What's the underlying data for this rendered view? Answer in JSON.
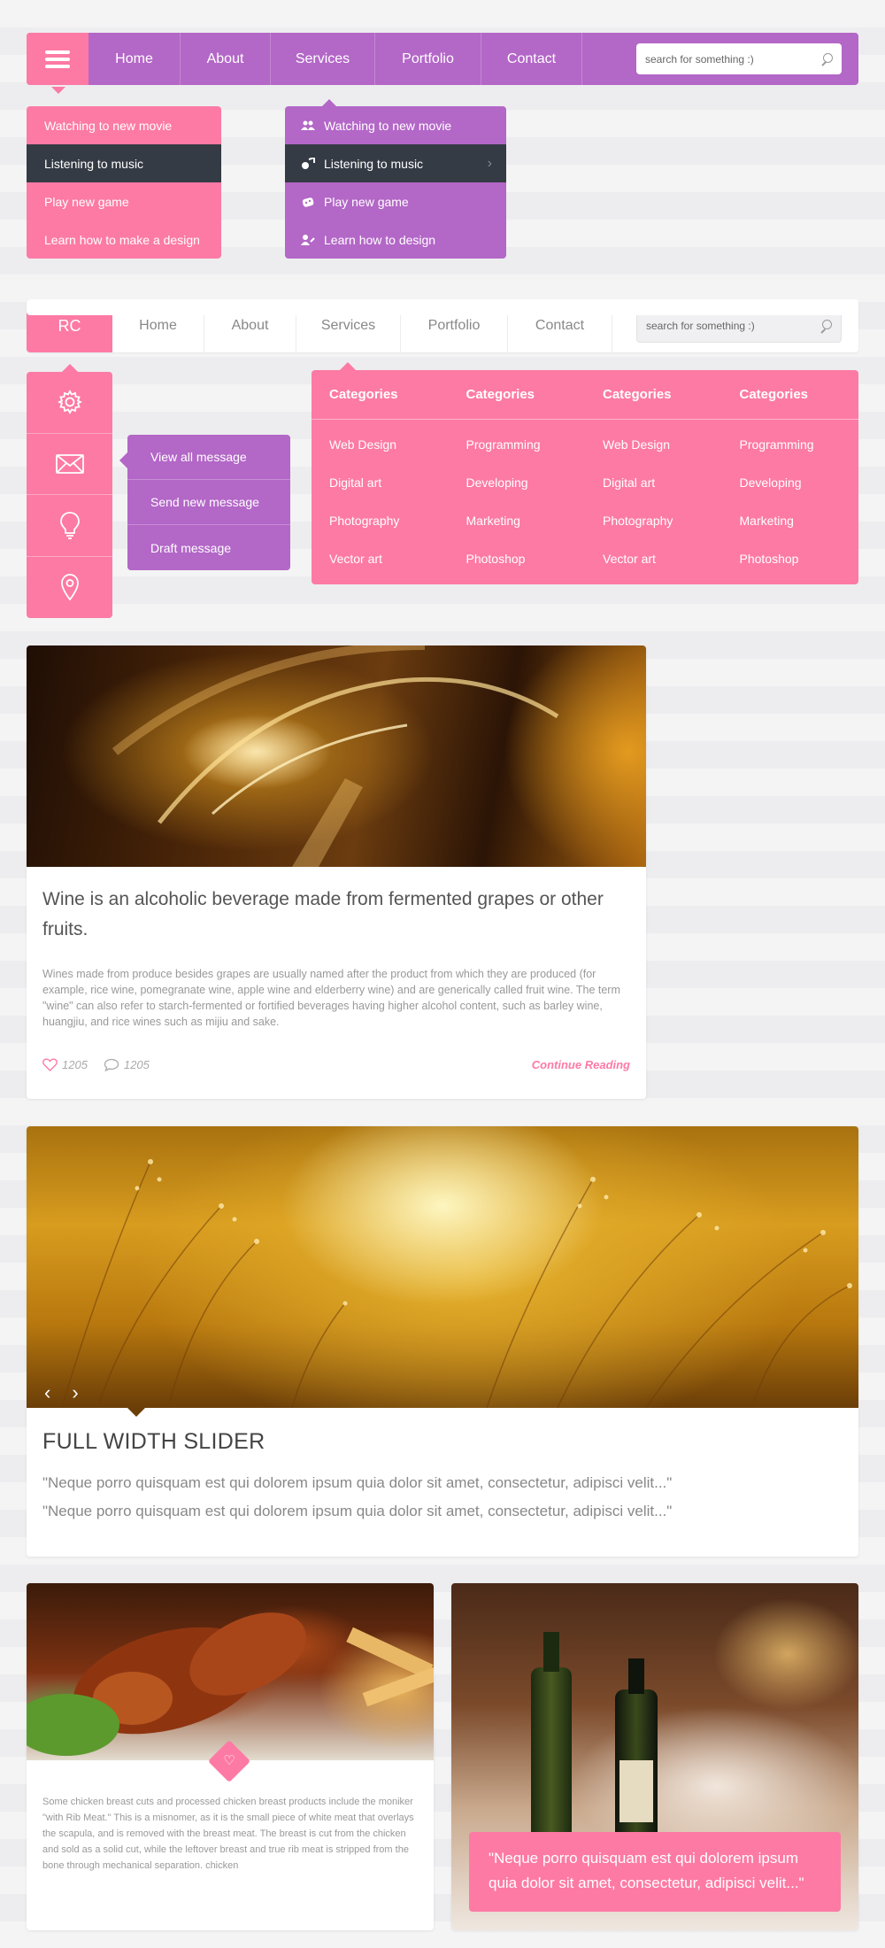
{
  "nav1": {
    "items": [
      "Home",
      "About",
      "Services",
      "Portfolio",
      "Contact"
    ],
    "search_placeholder": "search for something :)"
  },
  "dropdown1": {
    "items": [
      "Watching to new movie",
      "Listening to music",
      "Play new game",
      "Learn how to make a design"
    ]
  },
  "dropdown2": {
    "items": [
      "Watching to new movie",
      "Listening to music",
      "Play new game",
      "Learn how to design"
    ],
    "icons": [
      "users-icon",
      "music-icon",
      "gamepad-icon",
      "user-edit-icon"
    ]
  },
  "nav2": {
    "logo": "RC",
    "items": [
      "Home",
      "About",
      "Services",
      "Portfolio",
      "Contact"
    ],
    "search_placeholder": "search for something :)"
  },
  "iconbar": {
    "icons": [
      "gear-icon",
      "mail-icon",
      "lightbulb-icon",
      "location-pin-icon"
    ]
  },
  "message_menu": {
    "items": [
      "View all message",
      "Send new message",
      "Draft message"
    ]
  },
  "mega_menu": {
    "columns": [
      {
        "heading": "Categories",
        "links": [
          "Web Design",
          "Digital art",
          "Photography",
          "Vector art"
        ]
      },
      {
        "heading": "Categories",
        "links": [
          "Programming",
          "Developing",
          "Marketing",
          "Photoshop"
        ]
      },
      {
        "heading": "Categories",
        "links": [
          "Web Design",
          "Digital art",
          "Photography",
          "Vector art"
        ]
      },
      {
        "heading": "Categories",
        "links": [
          "Programming",
          "Developing",
          "Marketing",
          "Photoshop"
        ]
      }
    ]
  },
  "wine_card": {
    "title": "Wine is an alcoholic beverage made from fermented grapes or other fruits.",
    "text": "Wines made from produce besides grapes are usually named after the product from which they are produced (for example, rice wine, pomegranate wine, apple wine and elderberry wine) and are generically called fruit wine. The term \"wine\" can also refer to starch-fermented or fortified beverages having higher alcohol content, such as barley wine, huangjiu, and rice wines such as mijiu and sake.",
    "likes": "1205",
    "comments": "1205",
    "continue_label": "Continue Reading"
  },
  "slider": {
    "title": "FULL WIDTH SLIDER",
    "quote1": "\"Neque porro quisquam est qui dolorem ipsum quia dolor sit amet, consectetur, adipisci velit...\"",
    "quote2": "\"Neque porro quisquam est qui dolorem ipsum quia dolor sit amet, consectetur, adipisci velit...\"",
    "prev": "‹",
    "next": "›"
  },
  "chicken_card": {
    "text": "Some chicken breast cuts and processed chicken breast products include the moniker \"with Rib Meat.\" This is a misnomer, as it is the small piece of white meat that overlays the scapula, and is removed with the breast meat. The breast is cut from the chicken and sold as a solid cut, while the leftover breast and true rib meat is stripped from the bone through mechanical separation. chicken"
  },
  "dinner_card": {
    "quote": "\"Neque porro quisquam est qui dolorem ipsum quia dolor sit amet, consectetur, adipisci velit...\""
  },
  "colors": {
    "pink": "#fd7aa5",
    "purple": "#b367c7",
    "dark": "#353b45"
  }
}
